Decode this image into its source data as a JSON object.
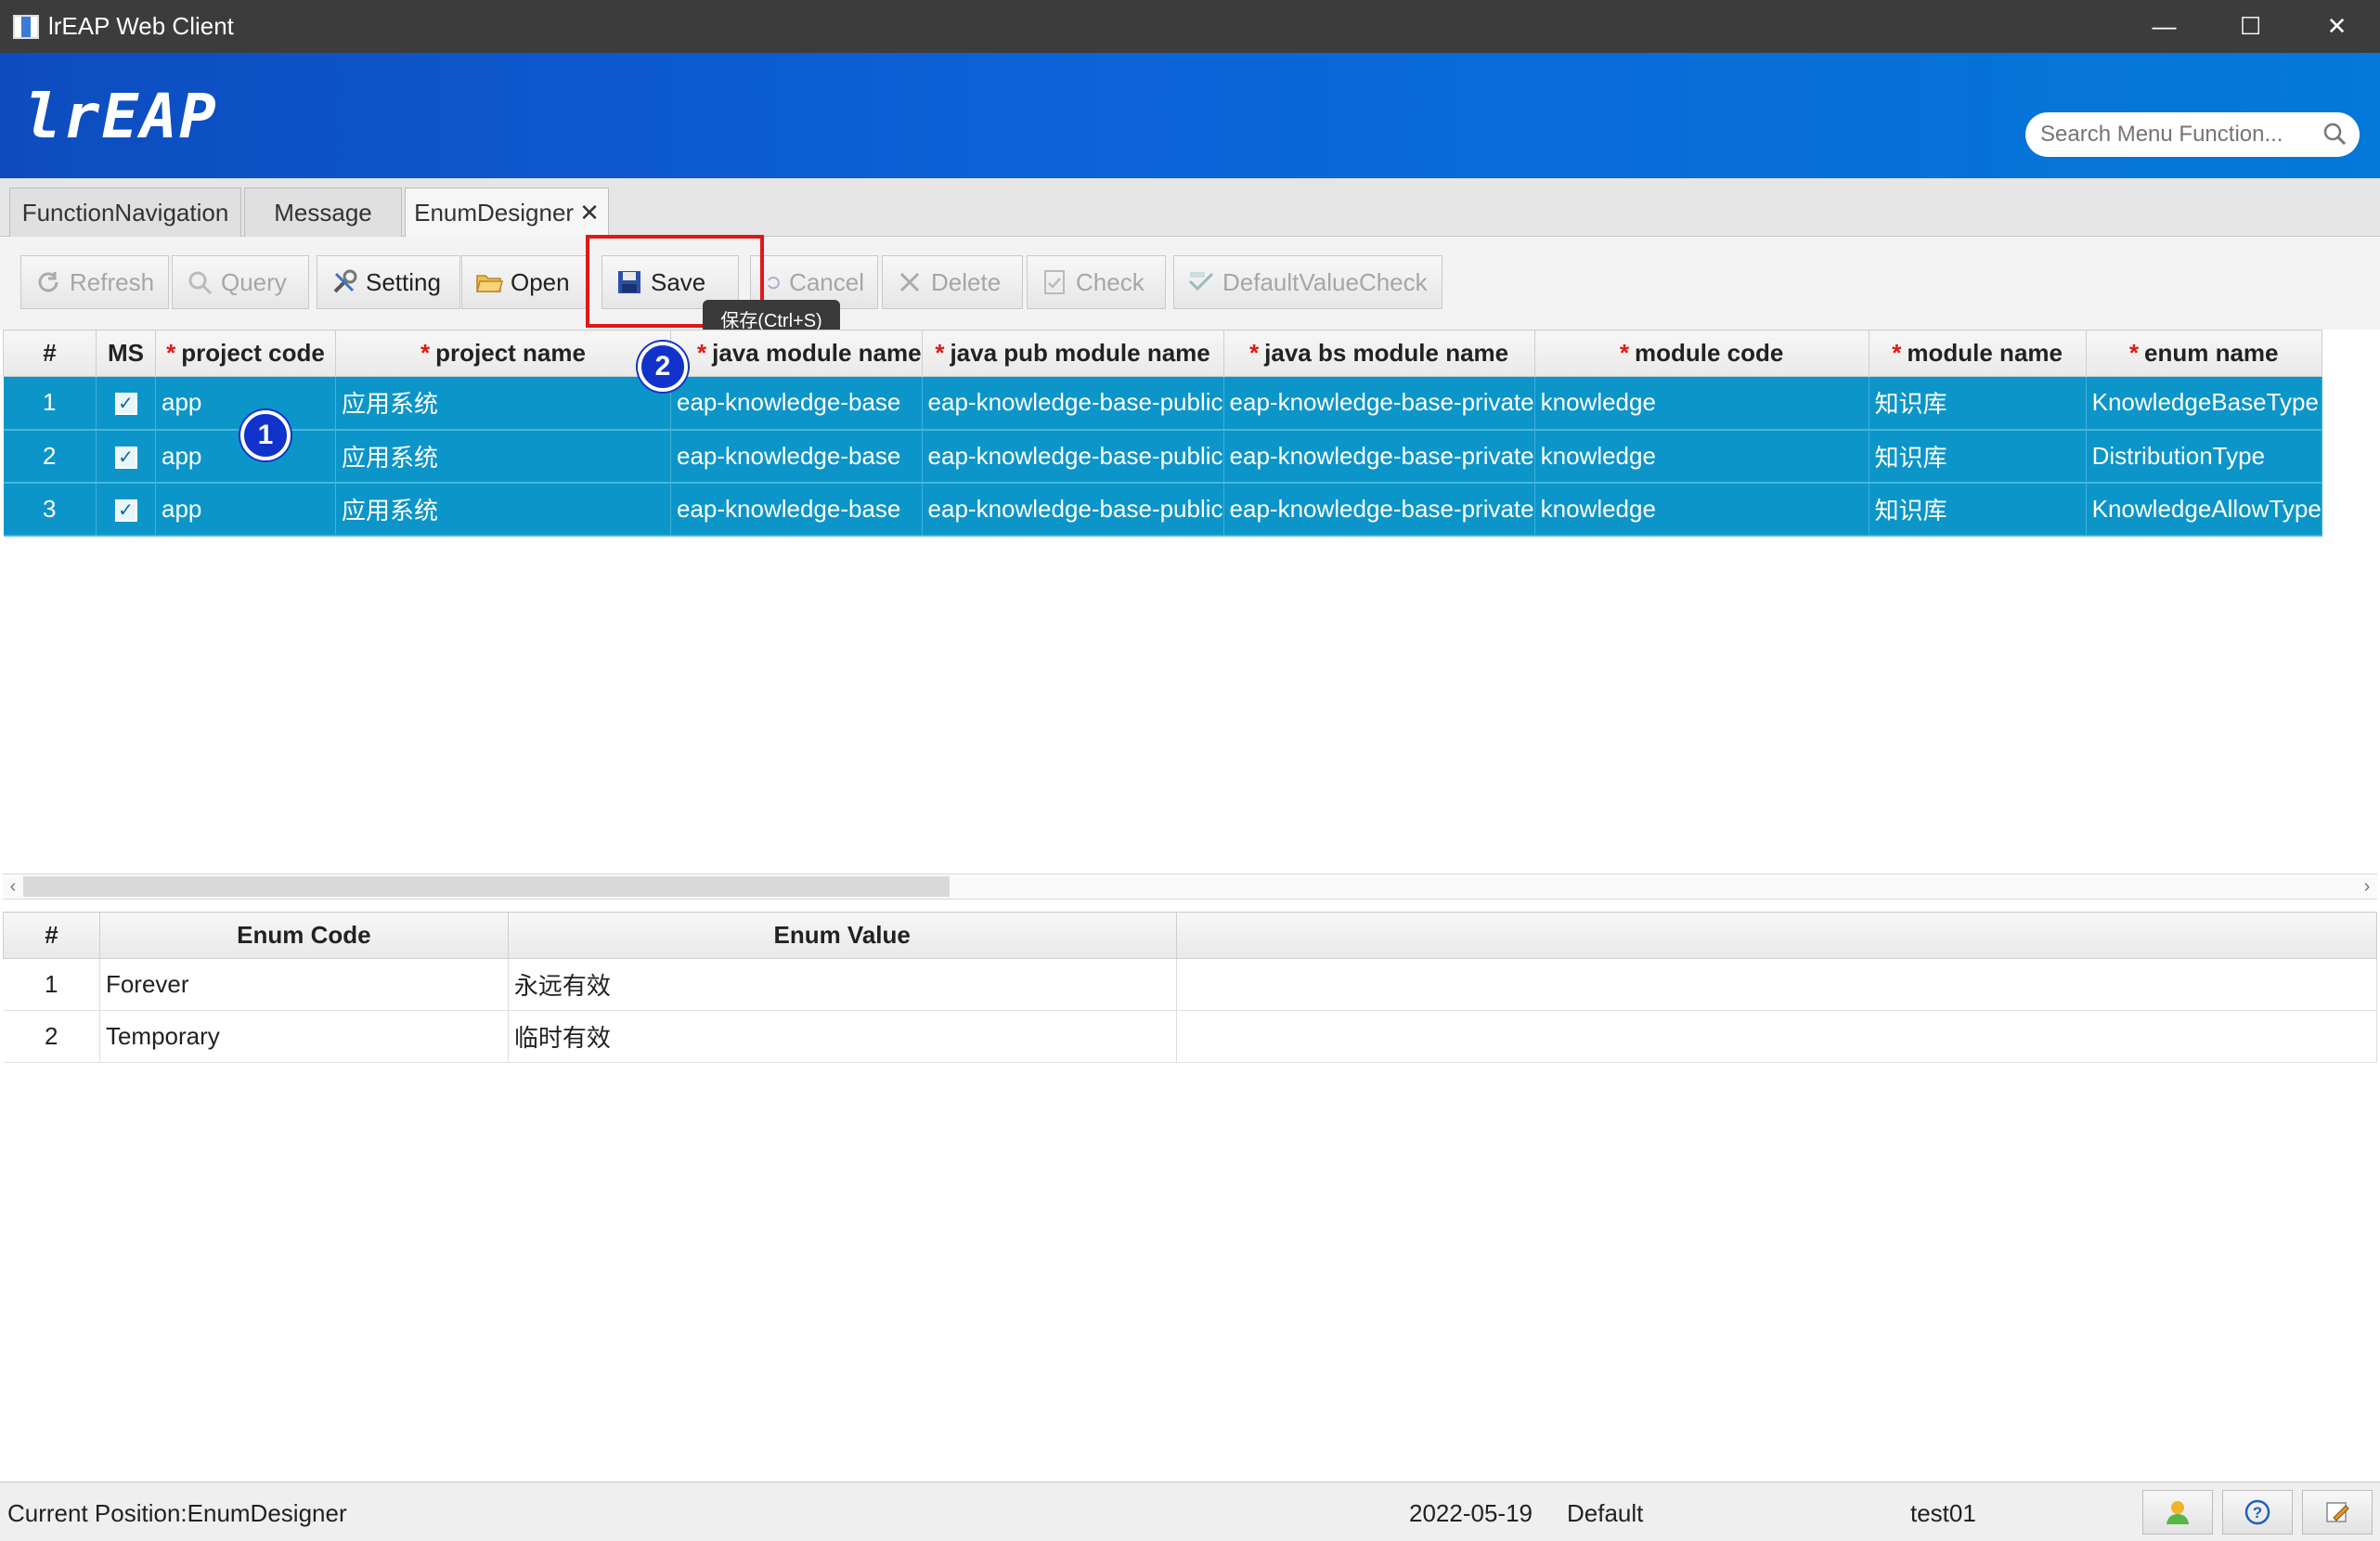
{
  "window": {
    "title": "lrEAP Web Client",
    "minimize": "—",
    "maximize": "☐",
    "close": "✕"
  },
  "header": {
    "logo": "lrEAP",
    "search_placeholder": "Search Menu Function..."
  },
  "tabs": [
    {
      "label": "FunctionNavigation"
    },
    {
      "label": "Message"
    },
    {
      "label": "EnumDesigner",
      "close": "✕"
    }
  ],
  "toolbar": {
    "refresh": "Refresh",
    "query": "Query",
    "setting": "Setting",
    "open": "Open",
    "save": "Save",
    "cancel": "Cancel",
    "delete": "Delete",
    "check": "Check",
    "default_value_check": "DefaultValueCheck",
    "tooltip": "保存(Ctrl+S)"
  },
  "annotations": {
    "badge1": "1",
    "badge2": "2"
  },
  "main_table": {
    "columns": [
      "#",
      "MS",
      "project code",
      "project name",
      "java module name",
      "java pub module name",
      "java bs module name",
      "module code",
      "module name",
      "enum name"
    ],
    "required_mark": "*",
    "rows": [
      {
        "num": "1",
        "ms": "✓",
        "project_code": "app",
        "project_name": "应用系统",
        "java_module": "eap-knowledge-base",
        "java_pub": "eap-knowledge-base-public",
        "java_bs": "eap-knowledge-base-private",
        "module_code": "knowledge",
        "module_name": "知识库",
        "enum_name": "KnowledgeBaseType"
      },
      {
        "num": "2",
        "ms": "✓",
        "project_code": "app",
        "project_name": "应用系统",
        "java_module": "eap-knowledge-base",
        "java_pub": "eap-knowledge-base-public",
        "java_bs": "eap-knowledge-base-private",
        "module_code": "knowledge",
        "module_name": "知识库",
        "enum_name": "DistributionType"
      },
      {
        "num": "3",
        "ms": "✓",
        "project_code": "app",
        "project_name": "应用系统",
        "java_module": "eap-knowledge-base",
        "java_pub": "eap-knowledge-base-public",
        "java_bs": "eap-knowledge-base-private",
        "module_code": "knowledge",
        "module_name": "知识库",
        "enum_name": "KnowledgeAllowType"
      }
    ]
  },
  "enum_table": {
    "columns": [
      "#",
      "Enum Code",
      "Enum Value"
    ],
    "rows": [
      {
        "num": "1",
        "code": "Forever",
        "value": "永远有效"
      },
      {
        "num": "2",
        "code": "Temporary",
        "value": "临时有效"
      }
    ]
  },
  "status": {
    "position": "Current Position:EnumDesigner",
    "date": "2022-05-19",
    "profile": "Default",
    "user": "test01"
  },
  "colors": {
    "selected_row": "#0c95c9",
    "header_blue": "#0c63d8",
    "highlight_red": "#e01818",
    "badge": "#1133cc"
  }
}
